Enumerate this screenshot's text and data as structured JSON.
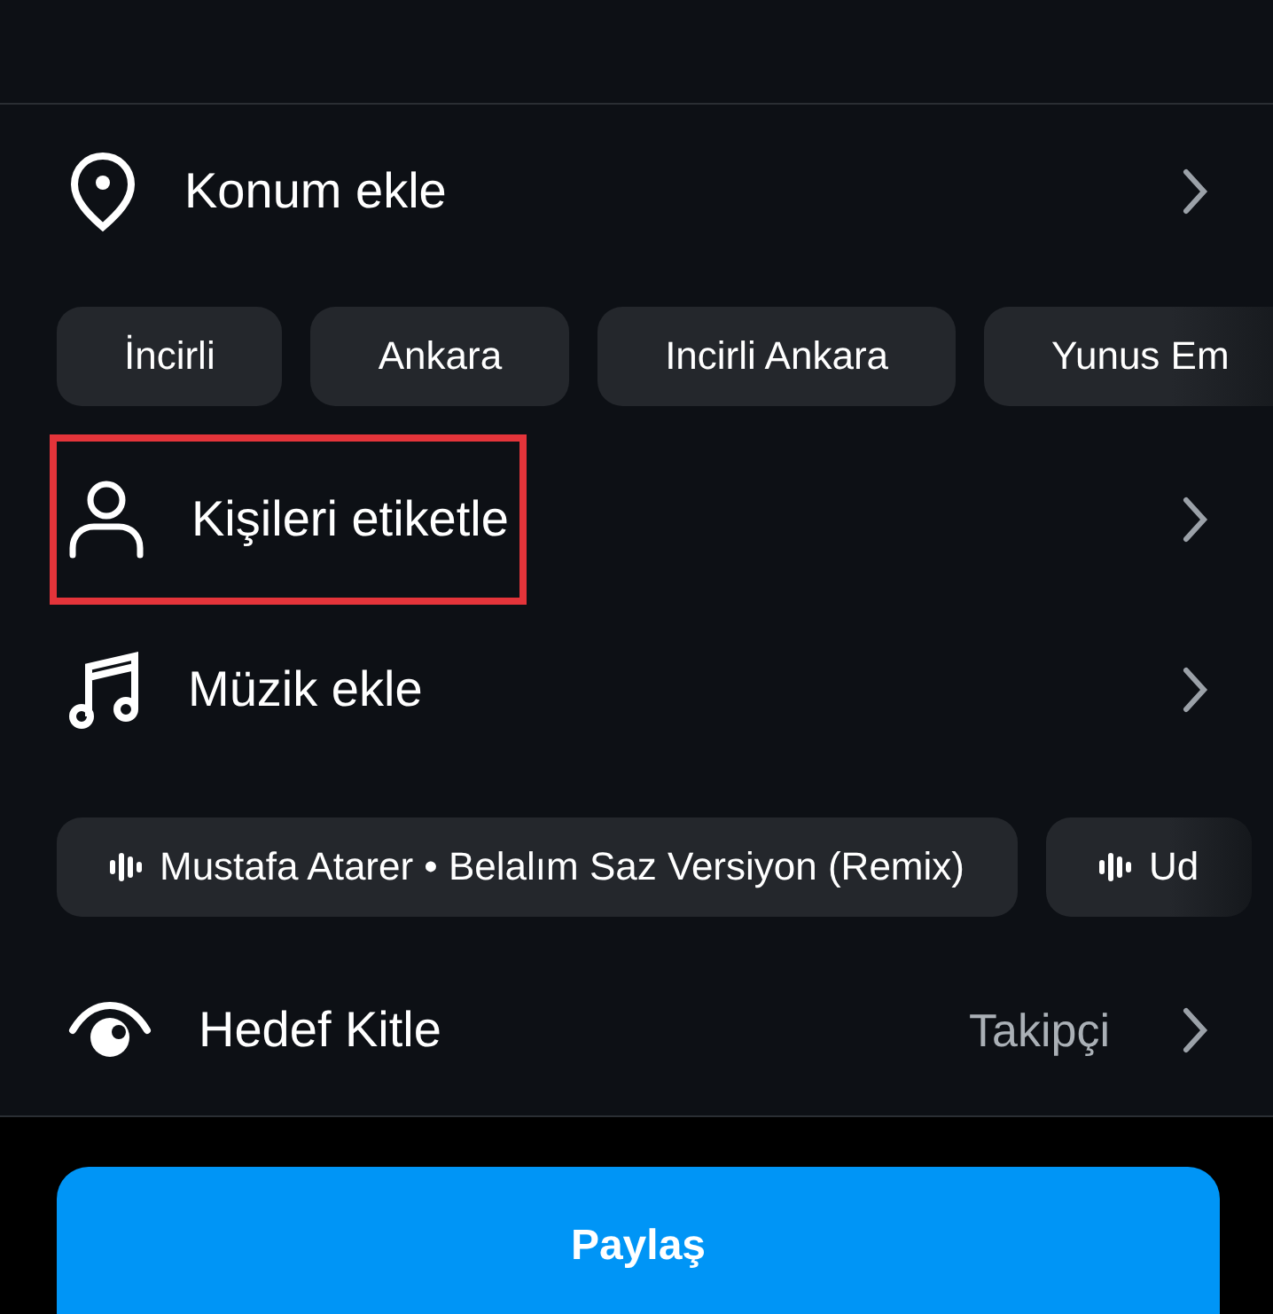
{
  "rows": [
    {
      "kind": "location",
      "label": "Konum ekle",
      "highlighted": false,
      "suggestions": [
        {
          "kind": "place",
          "label": "İncirli"
        },
        {
          "kind": "place",
          "label": "Ankara"
        },
        {
          "kind": "place",
          "label": "Incirli Ankara"
        },
        {
          "kind": "place",
          "label": "Yunus Em"
        }
      ]
    },
    {
      "kind": "person",
      "label": "Kişileri etiketle",
      "highlighted": true
    },
    {
      "kind": "music",
      "label": "Müzik ekle",
      "highlighted": false,
      "suggestions": [
        {
          "kind": "song",
          "label": "Mustafa Atarer • Belalım Saz Versiyon (Remix)"
        },
        {
          "kind": "song",
          "label": "Ud"
        }
      ]
    },
    {
      "kind": "audience",
      "label": "Hedef Kitle",
      "value": "Takipçi",
      "highlighted": false
    }
  ],
  "share_button": {
    "label": "Paylaş"
  }
}
